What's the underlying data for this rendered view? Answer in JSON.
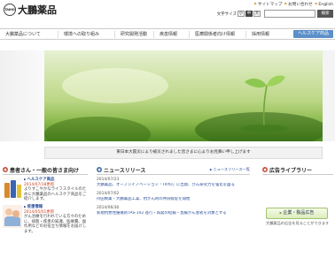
{
  "header": {
    "logo_mark": "TAIHO",
    "company_name": "大鵬薬品",
    "utility_links": [
      "サイトマップ",
      "お問い合わせ",
      "English"
    ],
    "font_size_label": "文字サイズ",
    "font_sizes": [
      "小",
      "中",
      "大"
    ],
    "search_placeholder": "",
    "search_button": "検索"
  },
  "nav": {
    "items": [
      "大鵬薬品について",
      "環境への取り組み",
      "研究開発活動",
      "疾患情報",
      "医療関係者向け情報",
      "採用情報"
    ],
    "health_button": "ヘルスケア商品"
  },
  "notice": {
    "text": "東日本大震災により被災されました皆さまに心よりお見舞い申し上げます"
  },
  "patients": {
    "title": "患者さん・一般の皆さま向け",
    "categories": [
      {
        "label": "ヘルスケア商品",
        "new": "2014/07/18更新",
        "description": "よりすこやかなライフスタイルのために大鵬薬品のヘルスケア商品をご紹介します。"
      },
      {
        "label": "疾患情報",
        "new": "2014/05/01更新",
        "description": "がん治療を行われている方々のために、病態・疾患の知識、医療費、副作用などのお役立ち情報をお届けします。"
      }
    ]
  },
  "news": {
    "title": "ニュースリリース",
    "more_link": "ニュースリリース一覧",
    "items": [
      {
        "date": "2014/07/23",
        "text": "大鵬薬品、オープンイノベーション「TKYO」に出資、がん研究力を強化を図る"
      },
      {
        "date": "2014/07/02",
        "text": "持田製薬・大鵬薬品工業、抗がん剤の共同販促を開始"
      },
      {
        "date": "2014/06/30",
        "text": "新規抗悪性腫瘍剤TAS-102 進行・再発の結腸・直腸がん患者を対象とする"
      }
    ]
  },
  "ads": {
    "title": "広告ライブラリー",
    "banner": "企業・製品広告",
    "note": "大鵬薬品の広告を見ることができます"
  }
}
